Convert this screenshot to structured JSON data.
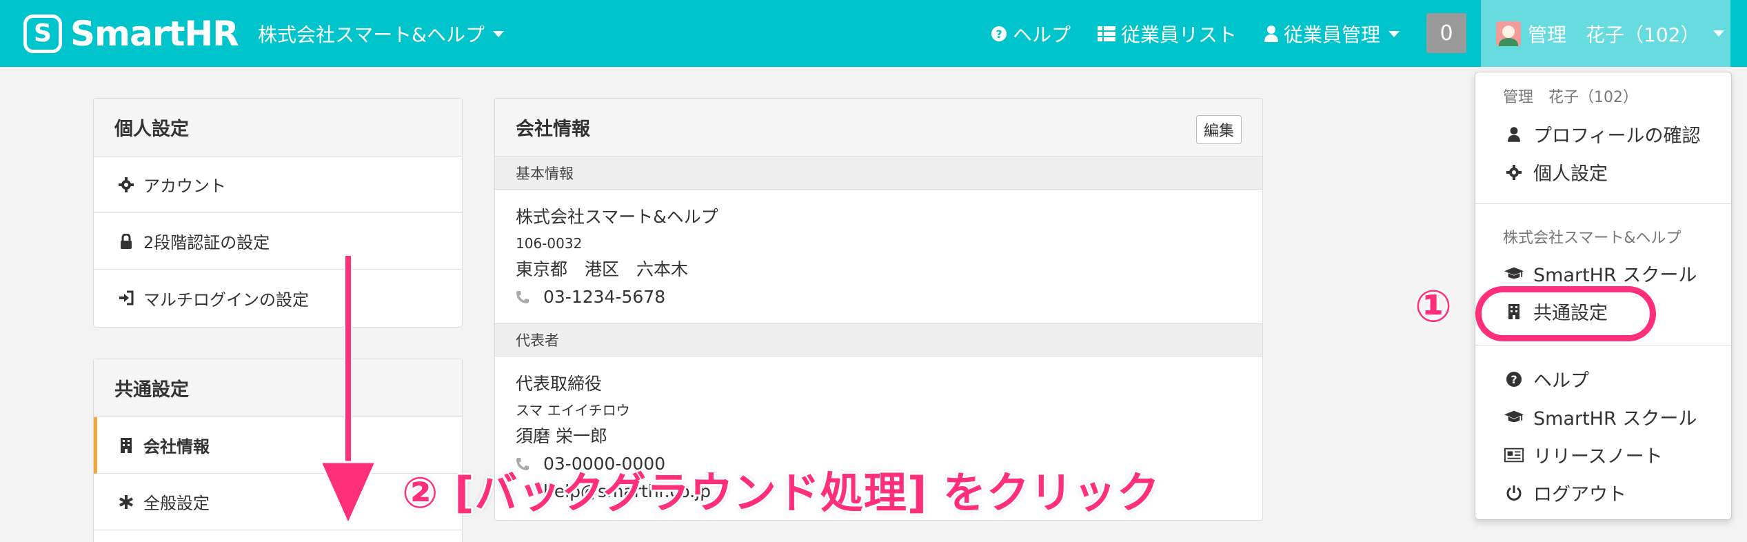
{
  "topbar": {
    "logo_text": "SmartHR",
    "company": "株式会社スマート&ヘルプ",
    "help": "ヘルプ",
    "employee_list": "従業員リスト",
    "employee_manage": "従業員管理",
    "notification_count": "0",
    "user_name": "管理　花子（102）"
  },
  "personal_settings": {
    "title": "個人設定",
    "items": [
      {
        "label": "アカウント",
        "icon": "gear-icon"
      },
      {
        "label": "2段階認証の設定",
        "icon": "lock-icon"
      },
      {
        "label": "マルチログインの設定",
        "icon": "sign-in-icon"
      }
    ]
  },
  "common_settings": {
    "title": "共通設定",
    "items": [
      {
        "label": "会社情報",
        "icon": "building-icon"
      },
      {
        "label": "全般設定",
        "icon": "asterisk-icon"
      }
    ]
  },
  "company_info": {
    "title": "会社情報",
    "edit_label": "編集",
    "basic_header": "基本情報",
    "company_name": "株式会社スマート&ヘルプ",
    "postal": "106-0032",
    "address": "東京都　港区　六本木",
    "phone": "03-1234-5678",
    "rep_header": "代表者",
    "rep_title": "代表取締役",
    "rep_kana": "スマ エイイチロウ",
    "rep_name": "須磨 栄一郎",
    "rep_phone": "03-0000-0000",
    "rep_email": "help@smarthr.co.jp"
  },
  "dropdown": {
    "user_header": "管理　花子（102）",
    "profile": "プロフィールの確認",
    "personal": "個人設定",
    "company_header": "株式会社スマート&ヘルプ",
    "school": "SmartHR スクール",
    "common": "共通設定",
    "help": "ヘルプ",
    "school2": "SmartHR スクール",
    "release_notes": "リリースノート",
    "logout": "ログアウト"
  },
  "annotations": {
    "step1": "①",
    "step2_text": "② [バックグラウンド処理] をクリック"
  },
  "colors": {
    "brand": "#00c4cc",
    "accent": "#ff2f7a",
    "active_bar": "#f0a73a"
  }
}
